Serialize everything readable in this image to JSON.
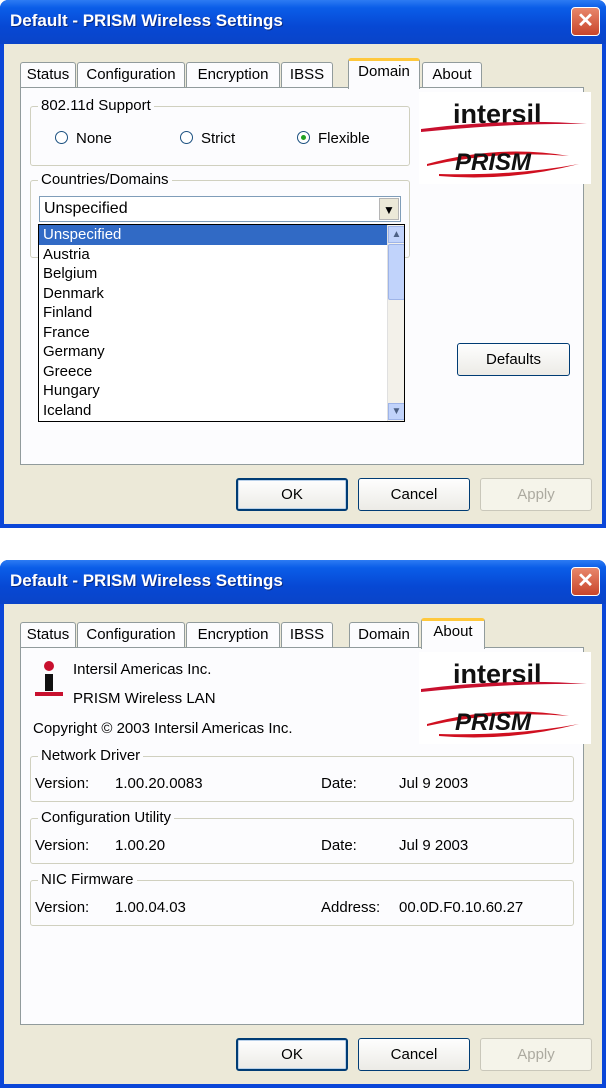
{
  "window1": {
    "title": "Default - PRISM Wireless Settings",
    "close_glyph": "✕",
    "tabs": [
      "Status",
      "Configuration",
      "Encryption",
      "IBSS",
      "Domain",
      "About"
    ],
    "active_tab": "Domain",
    "support_group": {
      "title": "802.11d Support",
      "options": [
        "None",
        "Strict",
        "Flexible"
      ],
      "selected": "Flexible"
    },
    "countries_group": {
      "title": "Countries/Domains",
      "combo_value": "Unspecified",
      "list": [
        "Unspecified",
        "Austria",
        "Belgium",
        "Denmark",
        "Finland",
        "France",
        "Germany",
        "Greece",
        "Hungary",
        "Iceland"
      ],
      "selected_item": "Unspecified"
    },
    "defaults_label": "Defaults",
    "ok_label": "OK",
    "cancel_label": "Cancel",
    "apply_label": "Apply"
  },
  "window2": {
    "title": "Default - PRISM Wireless Settings",
    "close_glyph": "✕",
    "tabs": [
      "Status",
      "Configuration",
      "Encryption",
      "IBSS",
      "Domain",
      "About"
    ],
    "active_tab": "About",
    "company": "Intersil Americas Inc.",
    "product": "PRISM Wireless LAN",
    "copyright": "Copyright © 2003  Intersil Americas Inc.",
    "sections": [
      {
        "title": "Network Driver",
        "left_label": "Version:",
        "left_value": "1.00.20.0083",
        "right_label": "Date:",
        "right_value": "Jul  9 2003"
      },
      {
        "title": "Configuration Utility",
        "left_label": "Version:",
        "left_value": "1.00.20",
        "right_label": "Date:",
        "right_value": "Jul  9 2003"
      },
      {
        "title": "NIC Firmware",
        "left_label": "Version:",
        "left_value": "1.00.04.03",
        "right_label": "Address:",
        "right_value": "00.0D.F0.10.60.27"
      }
    ],
    "ok_label": "OK",
    "cancel_label": "Cancel",
    "apply_label": "Apply"
  },
  "logos": {
    "intersil_text": "intersil",
    "prism_text": "PRISM",
    "colors": {
      "intersil_red": "#c8102e",
      "prism_red": "#d01020",
      "titlebar_blue": "#0a46d8",
      "selection_blue": "#316ac5",
      "tab_highlight": "#ffc83c"
    }
  },
  "icons": [
    "close-icon",
    "dropdown-arrow-icon",
    "scroll-up-icon",
    "scroll-down-icon",
    "intersil-info-icon"
  ]
}
